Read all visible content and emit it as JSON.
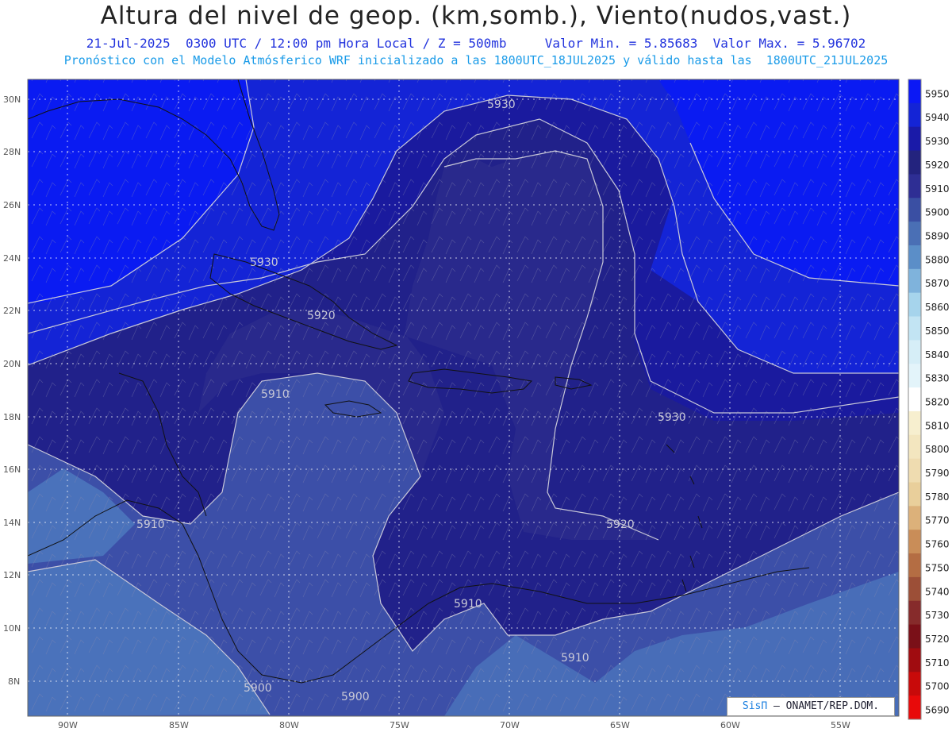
{
  "header": {
    "title": "Altura del nivel de geop. (km,somb.), Viento(nudos,vast.)",
    "line1": "21-Jul-2025  0300 UTC / 12:00 pm Hora Local / Z = 500mb     Valor Min. = 5.85683  Valor Max. = 5.96702",
    "line2": "Pronóstico con el Modelo Atmósferico WRF inicializado a las 1800UTC_18JUL2025 y válido hasta las  1800UTC_21JUL2025"
  },
  "map": {
    "lat_labels": [
      "30N",
      "28N",
      "26N",
      "24N",
      "22N",
      "20N",
      "18N",
      "16N",
      "14N",
      "12N",
      "10N",
      "8N"
    ],
    "lon_labels": [
      "90W",
      "85W",
      "80W",
      "75W",
      "70W",
      "65W",
      "60W",
      "55W"
    ],
    "contour_labels": [
      "5930",
      "5930",
      "5930",
      "5920",
      "5920",
      "5910",
      "5910",
      "5910",
      "5910",
      "5900",
      "5900"
    ],
    "colors": {
      "c5950": "#0a1bf2",
      "c5940": "#1424d6",
      "c5930": "#1a1a9e",
      "c5920": "#21218a",
      "c5910": "#2c2c92",
      "c5900": "#3c4fa8",
      "c5890": "#4a72bb"
    }
  },
  "colorbar": {
    "levels": [
      "5950",
      "5940",
      "5930",
      "5920",
      "5910",
      "5900",
      "5890",
      "5880",
      "5870",
      "5860",
      "5850",
      "5840",
      "5830",
      "5820",
      "5810",
      "5800",
      "5790",
      "5780",
      "5770",
      "5760",
      "5750",
      "5740",
      "5730",
      "5720",
      "5710",
      "5700",
      "5690"
    ],
    "colors": [
      "#0b18f5",
      "#1424d6",
      "#1a1aa8",
      "#23237e",
      "#2e2e94",
      "#3a4fa3",
      "#4a6fb5",
      "#5b8ec8",
      "#7fb3dc",
      "#a6d4ec",
      "#c2e4f3",
      "#d6eef7",
      "#e3f4fa",
      "#ffffff",
      "#f7efcf",
      "#f3e6bf",
      "#efdcb0",
      "#e9cf9b",
      "#dcb17a",
      "#c98d58",
      "#b46d43",
      "#9c4f37",
      "#862b2b",
      "#7a1018",
      "#a00c10",
      "#c80a0a",
      "#e80a0a"
    ]
  },
  "credit": {
    "brand": "SisΠ",
    "text": "– ONAMET/REP.DOM."
  }
}
